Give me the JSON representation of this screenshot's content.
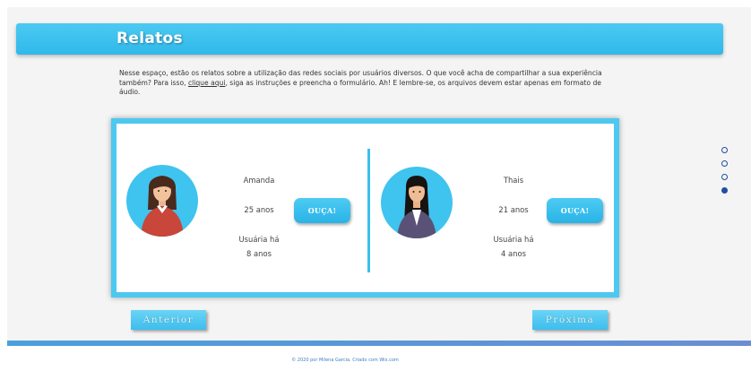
{
  "header": {
    "title": "Relatos"
  },
  "intro": {
    "before_link": "Nesse espaço, estão os relatos sobre a utilização das redes sociais por usuários diversos. O que você acha de compartilhar a sua experiência também? Para isso, ",
    "link_text": "clique aqui",
    "after_link": ", siga as instruções e preencha o formulário. Ah! E lembre-se, os arquivos devem estar apenas em formato de áudio."
  },
  "testimonials": [
    {
      "name": "Amanda",
      "age": "25 anos",
      "usage_line1": "Usuária há",
      "usage_line2": "8 anos",
      "button": "OUÇA!"
    },
    {
      "name": "Thais",
      "age": "21 anos",
      "usage_line1": "Usuária há",
      "usage_line2": "4 anos",
      "button": "OUÇA!"
    }
  ],
  "pagination": {
    "count": 4,
    "active_index": 3
  },
  "nav": {
    "prev": "Anterior",
    "next": "Próxima"
  },
  "footer": {
    "text": "© 2020 por Milena Garcia. Criado com Wix.com"
  },
  "colors": {
    "accent": "#39c0ee",
    "dot": "#1f4fa0",
    "footer_text": "#3a7fc4"
  },
  "icons": {
    "avatar_1": "woman-red-sweater-avatar",
    "avatar_2": "woman-dark-blazer-avatar"
  }
}
